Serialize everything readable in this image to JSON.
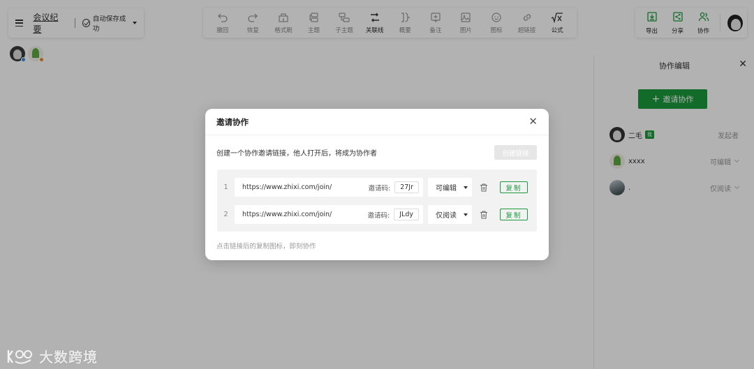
{
  "app": {
    "doc_title": "会议纪要",
    "save_status": "自动保存成功"
  },
  "toolbar": {
    "items": [
      {
        "label": "撤回",
        "icon": "undo-icon"
      },
      {
        "label": "恢复",
        "icon": "redo-icon"
      },
      {
        "label": "格式刷",
        "icon": "format-painter-icon"
      },
      {
        "label": "主题",
        "icon": "topic-icon"
      },
      {
        "label": "子主题",
        "icon": "subtopic-icon"
      },
      {
        "label": "关联线",
        "icon": "relation-line-icon"
      },
      {
        "label": "概要",
        "icon": "summary-icon"
      },
      {
        "label": "备注",
        "icon": "note-icon"
      },
      {
        "label": "图片",
        "icon": "image-icon"
      },
      {
        "label": "图标",
        "icon": "emoji-icon"
      },
      {
        "label": "超链接",
        "icon": "link-icon"
      },
      {
        "label": "公式",
        "icon": "formula-icon"
      }
    ]
  },
  "topright": {
    "export_label": "导出",
    "share_label": "分享",
    "collab_label": "协作"
  },
  "panel": {
    "title": "协作编辑",
    "invite_button": "邀请协作",
    "collaborators": [
      {
        "name": "二毛",
        "badge": "我",
        "role": "发起者"
      },
      {
        "name": "xxxx",
        "role": "可编辑"
      },
      {
        "name": ".",
        "role": "仅阅读"
      }
    ]
  },
  "modal": {
    "title": "邀请协作",
    "description": "创建一个协作邀请链接，他人打开后，将成为协作者",
    "create_button": "创建链接",
    "code_label": "邀请码:",
    "copy_label": "复制",
    "links": [
      {
        "index": "1",
        "url": "https://www.zhixi.com/join/",
        "code": "27Jr",
        "permission": "可编辑"
      },
      {
        "index": "2",
        "url": "https://www.zhixi.com/join/",
        "code": "JLdy",
        "permission": "仅阅读"
      }
    ],
    "hint": "点击链接后的复制图标，即刻协作"
  },
  "watermark": {
    "text": "大数跨境"
  },
  "colors": {
    "accent": "#1a9a3c",
    "presence_blue": "#3b8fe0",
    "presence_orange": "#f08a24"
  }
}
